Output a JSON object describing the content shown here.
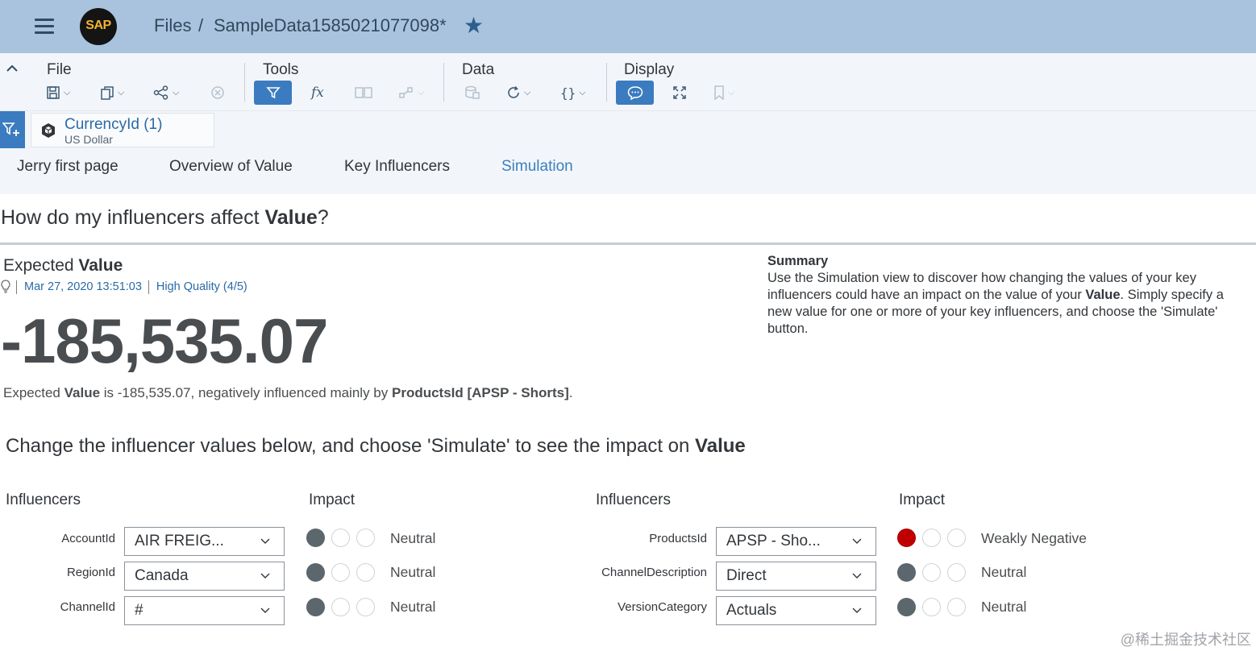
{
  "shell": {
    "logo_text": "SAP",
    "breadcrumb": {
      "files": "Files",
      "sep": "/",
      "document": "SampleData1585021077098*"
    }
  },
  "toolbar": {
    "groups": {
      "file": "File",
      "tools": "Tools",
      "data": "Data",
      "display": "Display"
    }
  },
  "filter": {
    "dimension": "CurrencyId (1)",
    "value": "US Dollar"
  },
  "tabs": [
    "Jerry first page",
    "Overview of Value",
    "Key Influencers",
    "Simulation"
  ],
  "active_tab": "Simulation",
  "question": {
    "prefix": "How do my influencers affect ",
    "measure": "Value",
    "suffix": "?"
  },
  "expected": {
    "title_prefix": "Expected ",
    "title_measure": "Value",
    "date": "Mar 27, 2020 13:51:03",
    "quality": "High Quality (4/5)",
    "number": "-185,535.07",
    "desc": {
      "p1": "Expected ",
      "b1": "Value",
      "p2": " is -185,535.07, negatively influenced mainly by ",
      "b2": "ProductsId [APSP - Shorts]",
      "p3": "."
    }
  },
  "summary": {
    "title": "Summary",
    "text_pre": "Use the Simulation view to discover how changing the values of your key influencers could have an impact on the value of your ",
    "text_bold": "Value",
    "text_post": ". Simply specify a new value for one or more of your key influencers, and choose the 'Simulate' button."
  },
  "change": {
    "prefix": "Change the influencer values below, and choose 'Simulate' to see the impact on ",
    "measure": "Value"
  },
  "influencers": {
    "col_influencers": "Influencers",
    "col_impact": "Impact",
    "left": [
      {
        "label": "AccountId",
        "value": "AIR FREIG...",
        "impact": "Neutral",
        "level": "neutral"
      },
      {
        "label": "RegionId",
        "value": "Canada",
        "impact": "Neutral",
        "level": "neutral"
      },
      {
        "label": "ChannelId",
        "value": "#",
        "impact": "Neutral",
        "level": "neutral"
      }
    ],
    "right": [
      {
        "label": "ProductsId",
        "value": "APSP - Sho...",
        "impact": "Weakly Negative",
        "level": "negative"
      },
      {
        "label": "ChannelDescription",
        "value": "Direct",
        "impact": "Neutral",
        "level": "neutral"
      },
      {
        "label": "VersionCategory",
        "value": "Actuals",
        "impact": "Neutral",
        "level": "neutral"
      }
    ]
  },
  "colors": {
    "shell_bg": "#a9c3de",
    "accent": "#3b7bbf",
    "negative": "#c00000",
    "neutral_dot": "#5c666d"
  },
  "watermark": "@稀土掘金技术社区"
}
